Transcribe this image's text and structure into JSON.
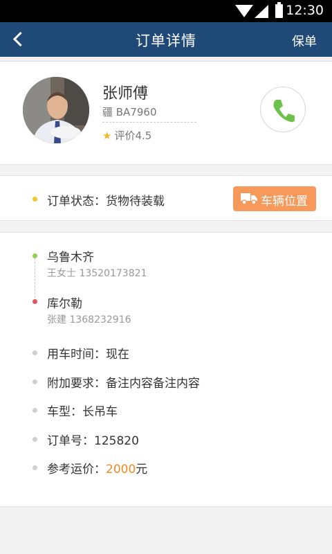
{
  "status_bar": {
    "time": "12:30"
  },
  "header": {
    "title": "订单详情",
    "action": "保单"
  },
  "driver": {
    "name": "张师傅",
    "plate": "疆 BA7960",
    "rating": "评价4.5"
  },
  "order_status": {
    "text": "订单状态：货物待装载",
    "location_button": "车辆位置"
  },
  "route": {
    "from": {
      "place": "乌鲁木齐",
      "contact": "王女士 13520173821"
    },
    "to": {
      "place": "库尔勒",
      "contact": "张建 1368232916"
    }
  },
  "details": {
    "time": "用车时间：现在",
    "extra": "附加要求：备注内容备注内容",
    "vehicle": "车型：长吊车",
    "order_no": "订单号：125820",
    "price_label": "参考运价：",
    "price_value": "2000",
    "price_unit": "元"
  },
  "colors": {
    "header": "#1f4a78",
    "accent_orange": "#f6995a",
    "price": "#f08a24",
    "phone_green": "#6cc24a",
    "status_dot": "#f2c531",
    "from_dot": "#8fd14a",
    "to_dot": "#e0585c"
  },
  "icons": [
    "wifi-icon",
    "signal-icon",
    "battery-icon",
    "back-icon",
    "star-icon",
    "phone-icon",
    "truck-icon"
  ]
}
